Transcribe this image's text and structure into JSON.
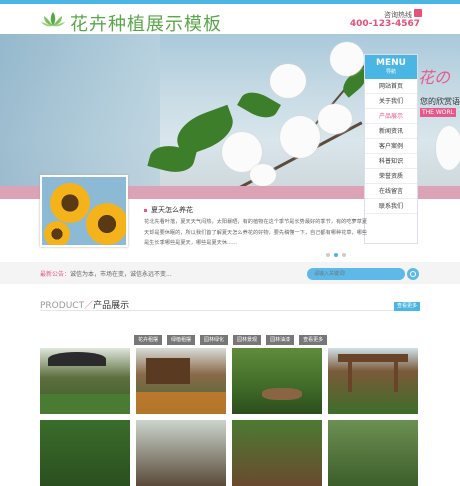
{
  "header": {
    "site_title": "花卉种植展示模板",
    "hotline_label": "咨询热线",
    "phone": "400-123-4567"
  },
  "banner": {
    "script_text": "花の",
    "subtitle": "您的欣赏语",
    "tag": "THE WORL"
  },
  "menu": {
    "title_en": "MENU",
    "title_cn": "导航",
    "items": [
      "网站首页",
      "关于我们",
      "产品展示",
      "新闻资讯",
      "客户案例",
      "科普知识",
      "荣誉资质",
      "在线留言",
      "联系我们"
    ],
    "active_index": 2
  },
  "news": {
    "title": "夏天怎么养花",
    "body": "花北先看叶落，夏天天气闷热，太阳暴晒，有的植物在这个季节是长势最好的季节，有的吃萝草夏天却是要休眠的，所以我们首了解夏天怎么养花的好物，要先稿懂一下，自己都有哪种花草，哪些是生长季哪些是夏天，哪些是夏天休......",
    "dots": 3,
    "active_dot": 1
  },
  "notice": {
    "label": "最新公告：",
    "text": "诚信为本，市场在变，诚信永远不变...",
    "search_placeholder": "请输入关键词!"
  },
  "products": {
    "heading_en": "PRODUCT",
    "slash": "／",
    "heading_cn": "产品展示",
    "more": "查看更多",
    "tabs": [
      "花卉租摆",
      "绿植租摆",
      "园林绿化",
      "园林景观",
      "园林油漆",
      "查看更多"
    ]
  },
  "colors": {
    "accent_blue": "#4ab6e4",
    "accent_pink": "#e9588a",
    "logo_green": "#5aa64a"
  }
}
